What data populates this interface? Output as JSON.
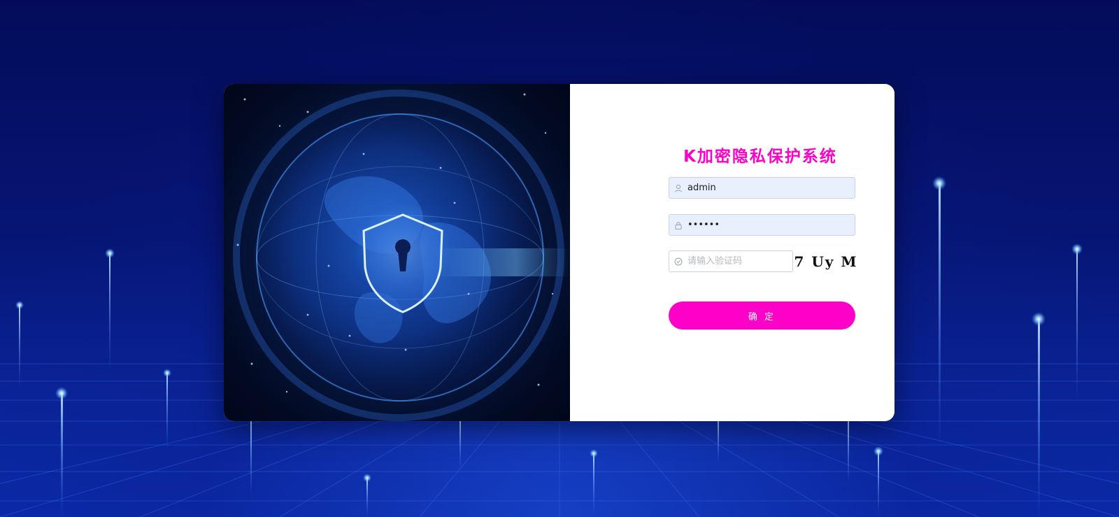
{
  "login": {
    "title": "K加密隐私保护系统",
    "username_value": "admin",
    "password_value": "••••••",
    "captcha_placeholder": "请输入验证码",
    "captcha_code": "7 Uy M",
    "submit_label": "确 定"
  },
  "icons": {
    "username": "user-icon",
    "password": "lock-icon",
    "captcha": "circle-check-icon"
  },
  "colors": {
    "accent": "#ff00c8",
    "input_fill": "#e8f0fe",
    "background": "#061574"
  }
}
